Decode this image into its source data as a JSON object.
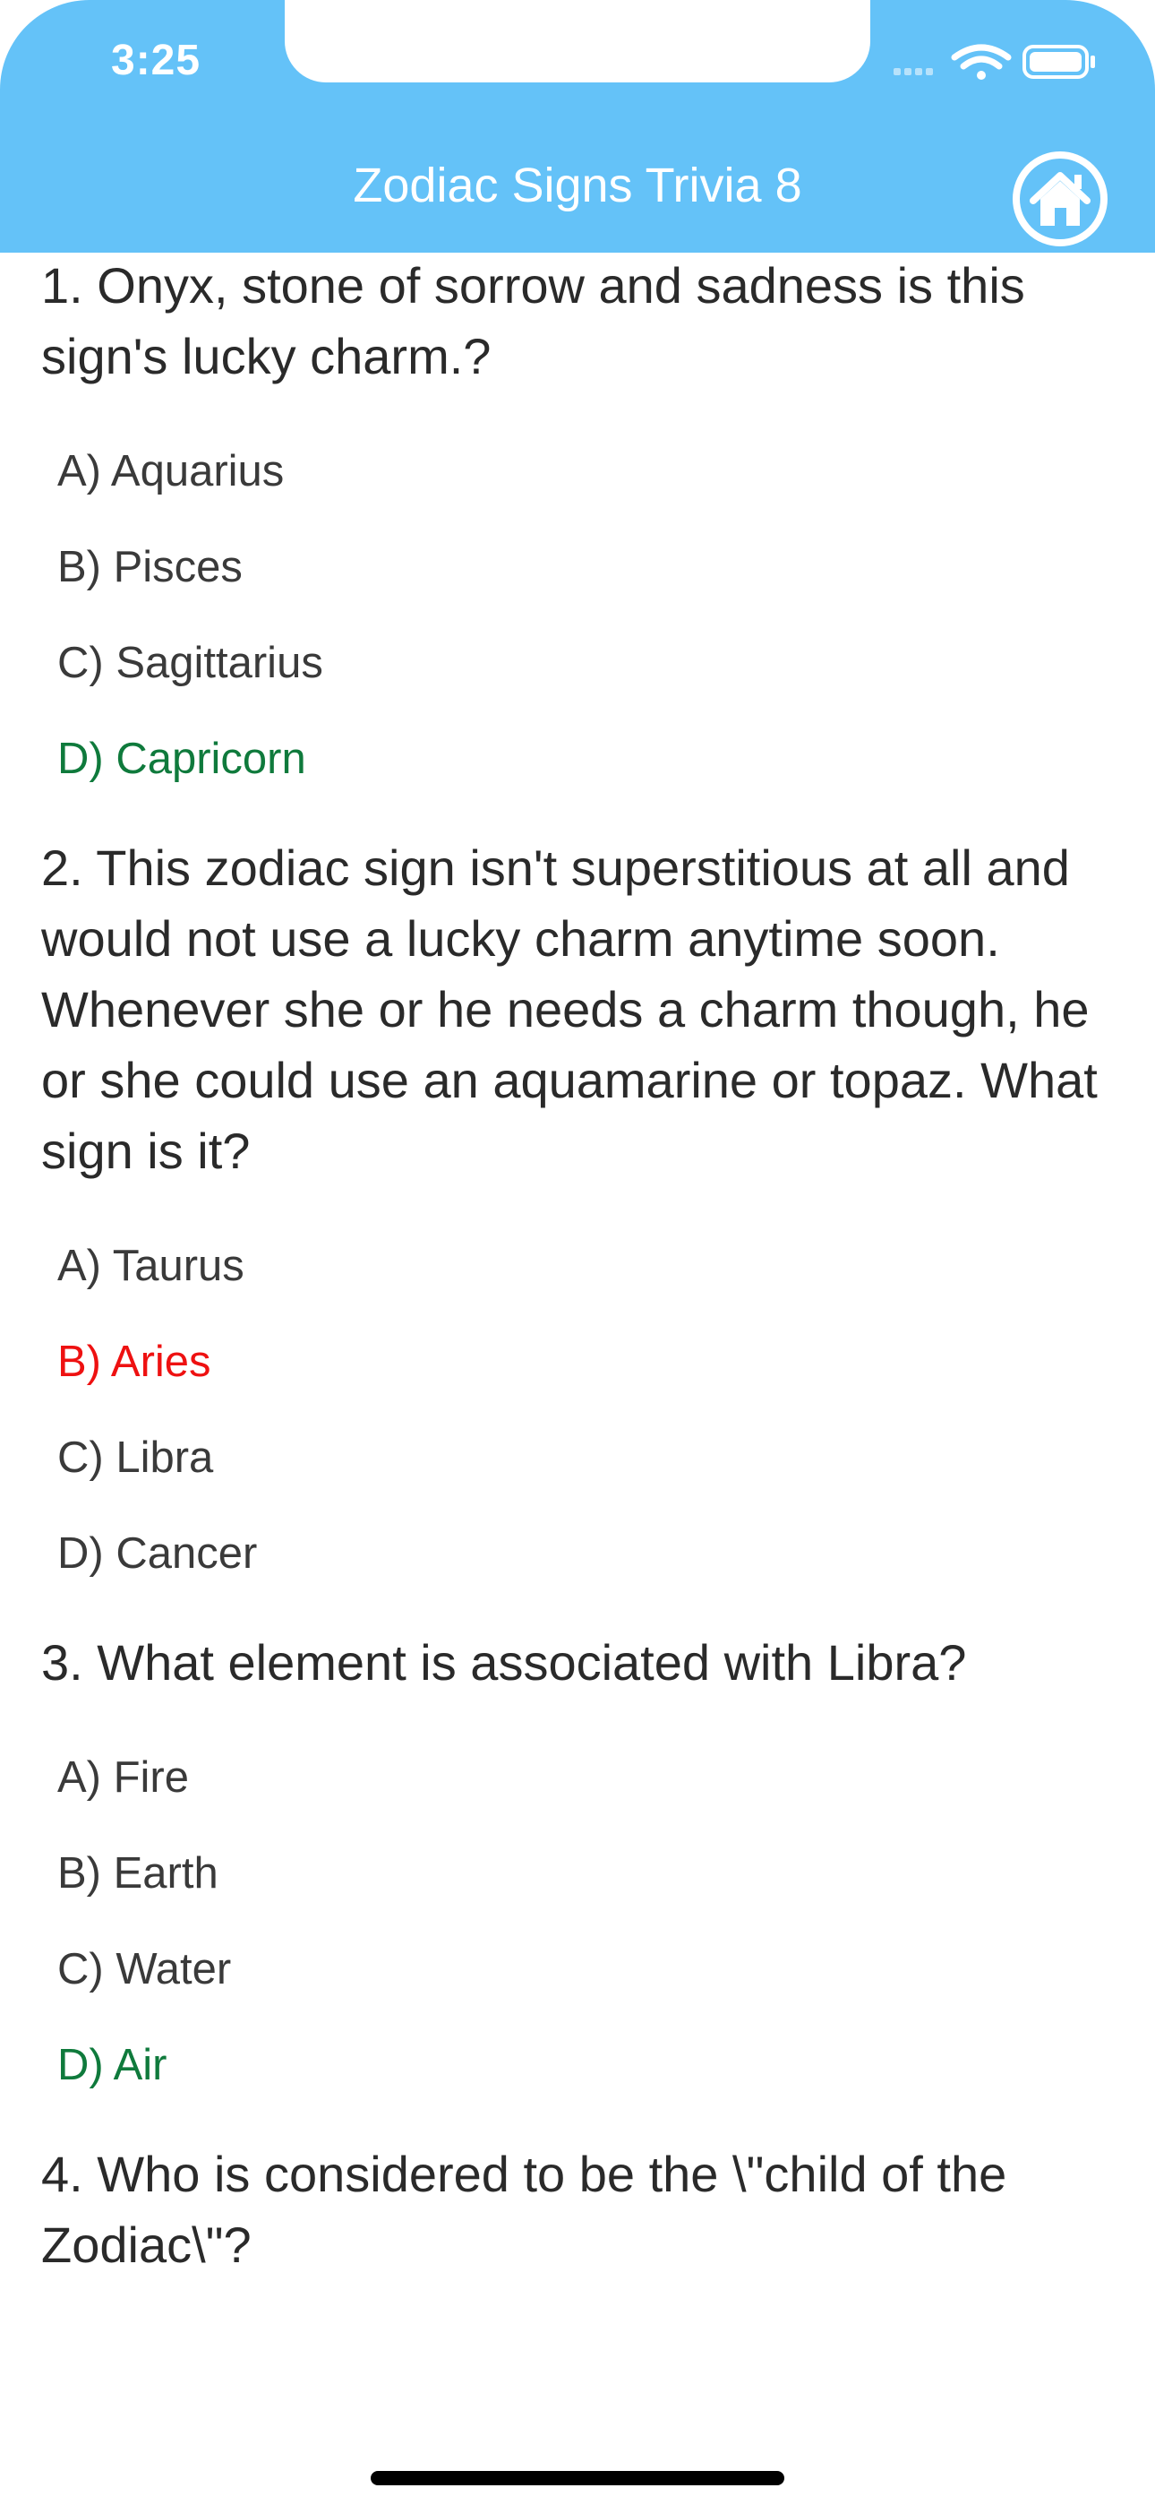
{
  "status_bar": {
    "time": "3:25",
    "icons": [
      "cellular-signal-icon",
      "wifi-icon",
      "battery-icon"
    ]
  },
  "nav": {
    "title": "Zodiac Signs Trivia 8",
    "home_icon": "home-icon"
  },
  "colors": {
    "header": "#64c2f8",
    "correct": "#0f7a3c",
    "wrong": "#ee1111"
  },
  "questions": [
    {
      "text": "1. Onyx, stone of sorrow and sadness is this sign's lucky charm.?",
      "options": [
        {
          "label": "A) Aquarius",
          "state": "neutral"
        },
        {
          "label": "B) Pisces",
          "state": "neutral"
        },
        {
          "label": "C) Sagittarius",
          "state": "neutral"
        },
        {
          "label": "D) Capricorn",
          "state": "correct"
        }
      ]
    },
    {
      "text": "2. This zodiac sign isn't superstitious at all and would not use a lucky charm anytime soon. Whenever she or he needs a charm though, he or she could use an aquamarine or topaz. What sign is it?",
      "options": [
        {
          "label": "A) Taurus",
          "state": "neutral"
        },
        {
          "label": "B) Aries",
          "state": "wrong"
        },
        {
          "label": "C) Libra",
          "state": "neutral"
        },
        {
          "label": "D) Cancer",
          "state": "neutral"
        }
      ]
    },
    {
      "text": "3. What element is associated with Libra?",
      "options": [
        {
          "label": "A) Fire",
          "state": "neutral"
        },
        {
          "label": "B) Earth",
          "state": "neutral"
        },
        {
          "label": "C) Water",
          "state": "neutral"
        },
        {
          "label": "D) Air",
          "state": "correct"
        }
      ]
    },
    {
      "text": "4. Who is considered to be the \\\"child of the Zodiac\\\"?",
      "options": []
    }
  ]
}
